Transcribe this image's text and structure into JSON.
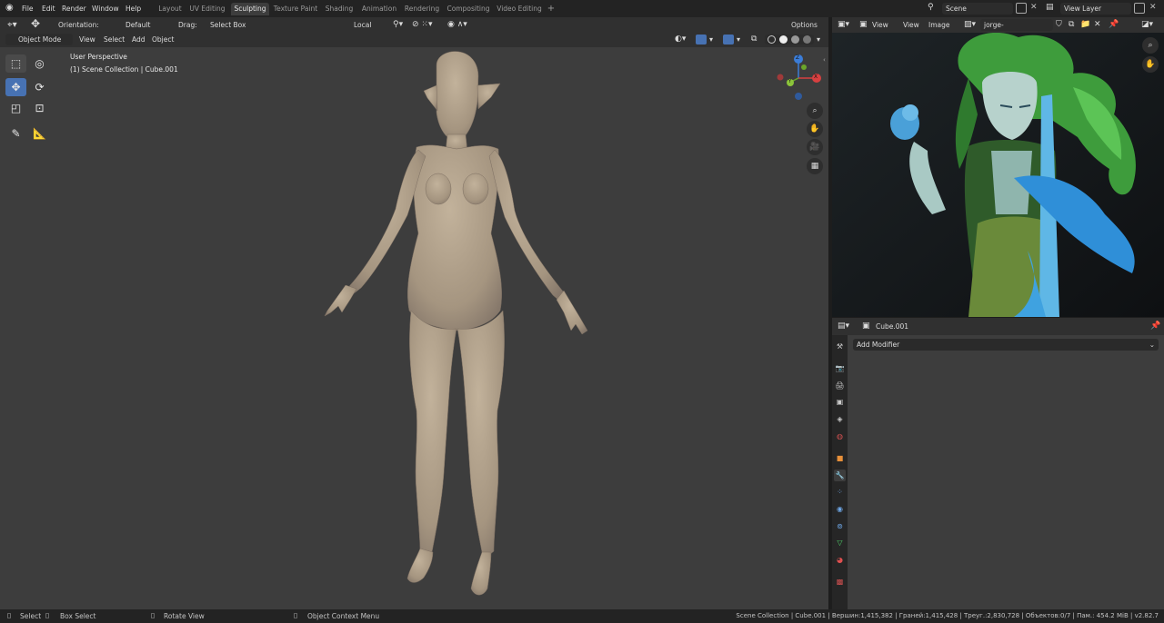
{
  "menu": [
    "File",
    "Edit",
    "Render",
    "Window",
    "Help"
  ],
  "workspace_tabs": [
    "Layout",
    "UV Editing",
    "Sculpting",
    "Texture Paint",
    "Shading",
    "Animation",
    "Rendering",
    "Compositing",
    "Video Editing"
  ],
  "active_tab": "Sculpting",
  "scene_name": "Scene",
  "view_layer": "View Layer",
  "viewport_header": {
    "orientation_label": "Orientation:",
    "orientation_value": "Default",
    "drag_label": "Drag:",
    "drag_value": "Select Box",
    "transform_space": "Local",
    "options": "Options",
    "mode": "Object Mode",
    "menus": [
      "View",
      "Select",
      "Add",
      "Object"
    ]
  },
  "viewport_overlay": {
    "perspective": "User Perspective",
    "collection": "(1) Scene Collection | Cube.001"
  },
  "gizmo": {
    "x": "X",
    "y": "Y",
    "z": "Z"
  },
  "image_editor": {
    "menus": [
      "View",
      "View",
      "Image"
    ],
    "image_name": "jorge-rodr...imegirl.jpg"
  },
  "properties": {
    "object_name": "Cube.001",
    "add_modifier": "Add Modifier"
  },
  "status_bar": {
    "select": "Select",
    "box_select": "Box Select",
    "rotate_view": "Rotate View",
    "context_menu": "Object Context Menu",
    "stats": "Scene Collection | Cube.001 | Вершин:1,415,382 | Граней:1,415,428 | Треуг.:2,830,728 | Объектов:0/7 | Пам.: 454.2 MiB | v2.82.7"
  },
  "colors": {
    "accent": "#4772b3",
    "viewport_bg": "#3d3d3d",
    "model_skin": "#b0a08a"
  }
}
